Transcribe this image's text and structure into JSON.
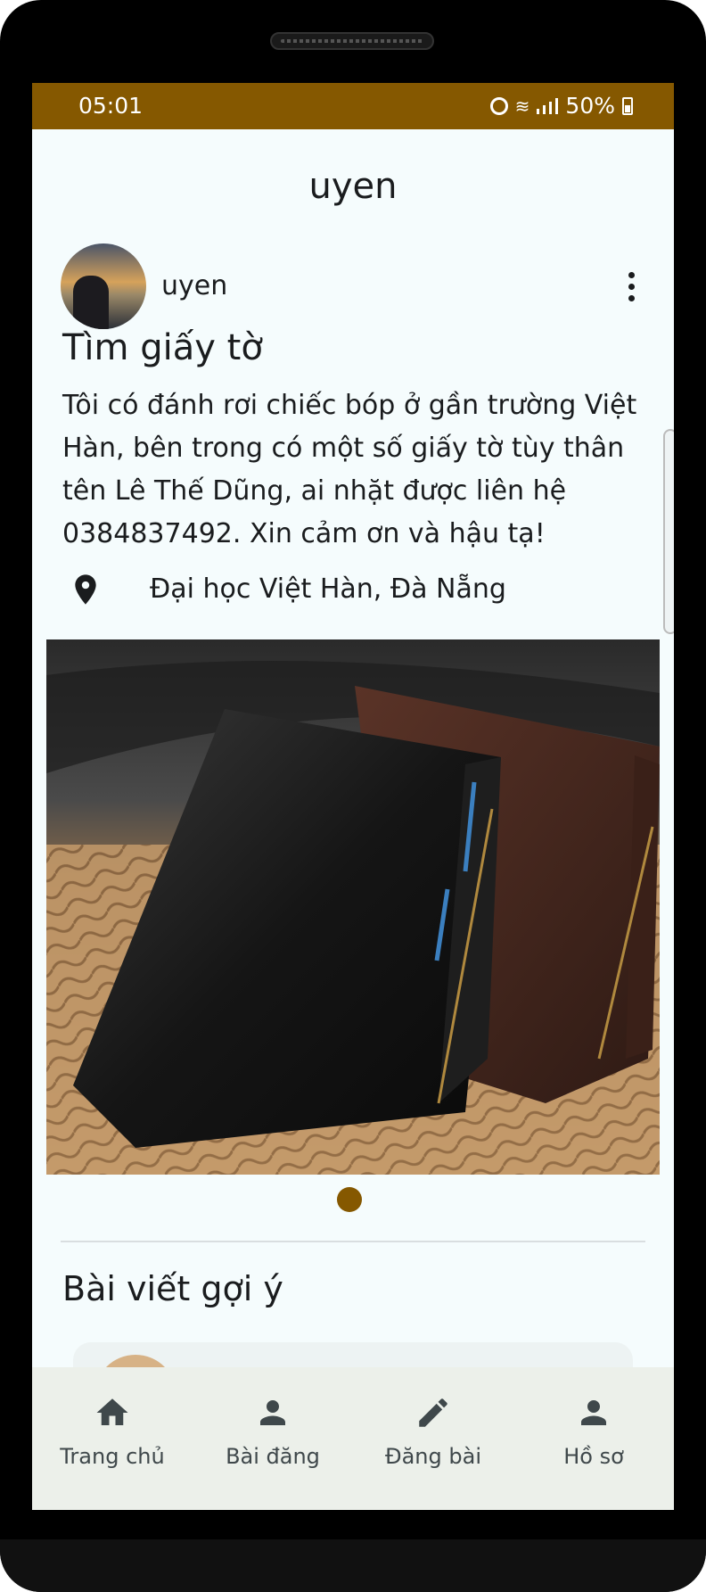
{
  "status_bar": {
    "time": "05:01",
    "battery": "50%"
  },
  "header": {
    "title": "uyen"
  },
  "post": {
    "author": "uyen",
    "title": "Tìm giấy tờ",
    "body": "Tôi có đánh rơi chiếc bóp ở gần trường Việt Hàn, bên trong có một số giấy tờ tùy thân tên Lê Thế Dũng, ai nhặt được liên hệ 0384837492. Xin cảm ơn và hậu tạ!",
    "location": "Đại học Việt Hàn, Đà Nẵng"
  },
  "suggestions": {
    "title": "Bài viết gợi ý"
  },
  "bottom_nav": [
    {
      "label": "Trang chủ",
      "icon": "home-icon"
    },
    {
      "label": "Bài đăng",
      "icon": "person-icon"
    },
    {
      "label": "Đăng bài",
      "icon": "pencil-icon"
    },
    {
      "label": "Hồ sơ",
      "icon": "person-icon"
    }
  ],
  "colors": {
    "accent": "#855800",
    "background": "#f5fcfd",
    "nav_background": "#ecf0ea"
  }
}
